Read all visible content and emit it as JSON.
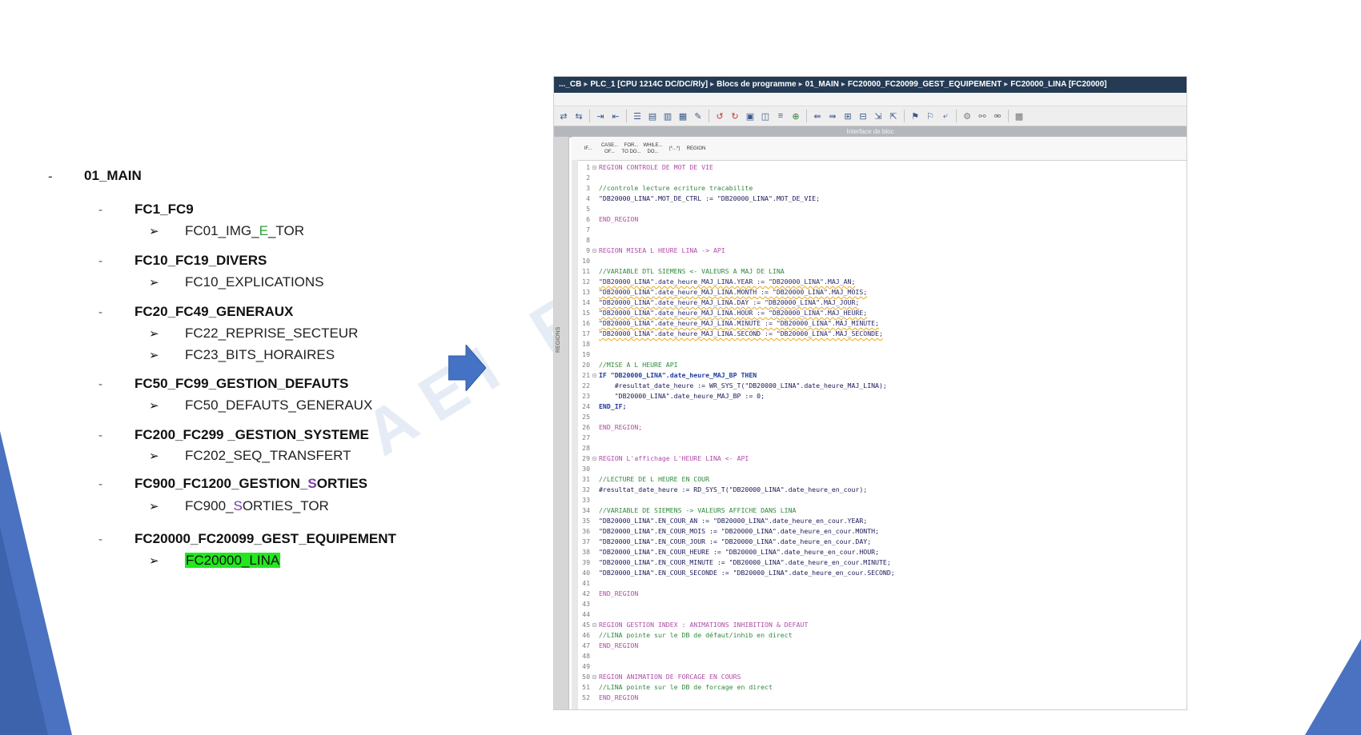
{
  "outline": {
    "root": {
      "dash": "-",
      "label": "01_MAIN"
    },
    "sections": [
      {
        "dash": "-",
        "label": "FC1_FC9",
        "items": [
          {
            "arrow": "➢",
            "parts": [
              {
                "text": "FC01_IMG_"
              },
              {
                "text": "E",
                "style": "green"
              },
              {
                "text": "_TOR"
              }
            ]
          }
        ]
      },
      {
        "dash": "-",
        "label": "FC10_FC19_DIVERS",
        "items": [
          {
            "arrow": "➢",
            "parts": [
              {
                "text": "FC10_EXPLICATIONS"
              }
            ]
          }
        ]
      },
      {
        "dash": "-",
        "label": "FC20_FC49_GENERAUX",
        "items": [
          {
            "arrow": "➢",
            "parts": [
              {
                "text": "FC22_REPRISE_SECTEUR"
              }
            ]
          },
          {
            "arrow": "➢",
            "parts": [
              {
                "text": "FC23_BITS_HORAIRES"
              }
            ]
          }
        ]
      },
      {
        "dash": "-",
        "label": "FC50_FC99_GESTION_DEFAUTS",
        "items": [
          {
            "arrow": "➢",
            "parts": [
              {
                "text": "FC50_DEFAUTS_GENERAUX"
              }
            ]
          }
        ]
      },
      {
        "dash": "-",
        "label": "FC200_FC299 _GESTION_SYSTEME",
        "items": [
          {
            "arrow": "➢",
            "parts": [
              {
                "text": "FC202_SEQ_TRANSFERT"
              }
            ]
          }
        ]
      },
      {
        "dash": "-",
        "label_parts": [
          {
            "text": "FC900_FC1200_GESTION_"
          },
          {
            "text": "S",
            "style": "purple"
          },
          {
            "text": "ORTIES"
          }
        ],
        "items": [
          {
            "arrow": "➢",
            "parts": [
              {
                "text": "FC900_"
              },
              {
                "text": "S",
                "style": "purple"
              },
              {
                "text": "ORTIES_TOR"
              }
            ]
          }
        ]
      },
      {
        "dash": "-",
        "label": "FC20000_FC20099_GEST_EQUIPEMENT",
        "items": [
          {
            "arrow": "➢",
            "parts": [
              {
                "text": "FC20000_LINA",
                "style": "highlight"
              }
            ]
          }
        ]
      }
    ]
  },
  "watermark": "AEI FO",
  "editor": {
    "breadcrumb": [
      "..._CB",
      "PLC_1 [CPU 1214C DC/DC/Rly]",
      "Blocs de programme",
      "01_MAIN",
      "FC20000_FC20099_GEST_EQUIPEMENT",
      "FC20000_LINA [FC20000]"
    ],
    "breadcrumb_separator": "▸",
    "interface_label": "Interface de bloc",
    "side_label": "REGIONS",
    "snippets": [
      "IF...",
      "CASE... OF...",
      "FOR... TO DO...",
      "WHILE... DO...",
      "(*...*)",
      "REGION"
    ],
    "code_lines": [
      {
        "n": "1",
        "fold": "⊟",
        "text": "REGION CONTROLE DE MOT DE VIE",
        "type": "region"
      },
      {
        "n": "2",
        "fold": "",
        "text": "",
        "type": "plain"
      },
      {
        "n": "3",
        "fold": "",
        "text": "//controle lecture ecriture tracabilite",
        "type": "comment"
      },
      {
        "n": "4",
        "fold": "",
        "text": "\"DB20000_LINA\".MOT_DE_CTRL := \"DB20000_LINA\".MOT_DE_VIE;",
        "type": "plain"
      },
      {
        "n": "5",
        "fold": "",
        "text": "",
        "type": "plain"
      },
      {
        "n": "6",
        "fold": "",
        "text": "END_REGION",
        "type": "region"
      },
      {
        "n": "7",
        "fold": "",
        "text": "",
        "type": "plain"
      },
      {
        "n": "8",
        "fold": "",
        "text": "",
        "type": "plain"
      },
      {
        "n": "9",
        "fold": "⊟",
        "text": "REGION MISEA L HEURE LINA -> API",
        "type": "region"
      },
      {
        "n": "10",
        "fold": "",
        "text": "",
        "type": "plain"
      },
      {
        "n": "11",
        "fold": "",
        "text": "//VARIABLE DTL SIEMENS <- VALEURS A MAJ DE LINA",
        "type": "comment"
      },
      {
        "n": "12",
        "fold": "",
        "text": "\"DB20000_LINA\".date_heure_MAJ_LINA.YEAR := \"DB20000_LINA\".MAJ_AN;",
        "type": "warn"
      },
      {
        "n": "13",
        "fold": "",
        "text": "\"DB20000_LINA\".date_heure_MAJ_LINA.MONTH := \"DB20000_LINA\".MAJ_MOIS;",
        "type": "warn"
      },
      {
        "n": "14",
        "fold": "",
        "text": "\"DB20000_LINA\".date_heure_MAJ_LINA.DAY := \"DB20000_LINA\".MAJ_JOUR;",
        "type": "warn"
      },
      {
        "n": "15",
        "fold": "",
        "text": "\"DB20000_LINA\".date_heure_MAJ_LINA.HOUR := \"DB20000_LINA\".MAJ_HEURE;",
        "type": "warn"
      },
      {
        "n": "16",
        "fold": "",
        "text": "\"DB20000_LINA\".date_heure_MAJ_LINA.MINUTE := \"DB20000_LINA\".MAJ_MINUTE;",
        "type": "warn"
      },
      {
        "n": "17",
        "fold": "",
        "text": "\"DB20000_LINA\".date_heure_MAJ_LINA.SECOND := \"DB20000_LINA\".MAJ_SECONDE;",
        "type": "warn"
      },
      {
        "n": "18",
        "fold": "",
        "text": "",
        "type": "plain"
      },
      {
        "n": "19",
        "fold": "",
        "text": "",
        "type": "plain"
      },
      {
        "n": "20",
        "fold": "",
        "text": "//MISE A L HEURE API",
        "type": "comment"
      },
      {
        "n": "21",
        "fold": "⊟",
        "text": "IF \"DB20000_LINA\".date_heure_MAJ_BP THEN",
        "type": "kw"
      },
      {
        "n": "22",
        "fold": "",
        "text": "    #resultat_date_heure := WR_SYS_T(\"DB20000_LINA\".date_heure_MAJ_LINA);",
        "type": "plain"
      },
      {
        "n": "23",
        "fold": "",
        "text": "    \"DB20000_LINA\".date_heure_MAJ_BP := 0;",
        "type": "plain"
      },
      {
        "n": "24",
        "fold": "",
        "text": "END_IF;",
        "type": "kw"
      },
      {
        "n": "25",
        "fold": "",
        "text": "",
        "type": "plain"
      },
      {
        "n": "26",
        "fold": "",
        "text": "END_REGION;",
        "type": "region"
      },
      {
        "n": "27",
        "fold": "",
        "text": "",
        "type": "plain"
      },
      {
        "n": "28",
        "fold": "",
        "text": "",
        "type": "plain"
      },
      {
        "n": "29",
        "fold": "⊟",
        "text": "REGION L'affichage L'HEURE LINA <- API",
        "type": "region"
      },
      {
        "n": "30",
        "fold": "",
        "text": "",
        "type": "plain"
      },
      {
        "n": "31",
        "fold": "",
        "text": "//LECTURE DE L HEURE EN COUR",
        "type": "comment"
      },
      {
        "n": "32",
        "fold": "",
        "text": "#resultat_date_heure := RD_SYS_T(\"DB20000_LINA\".date_heure_en_cour);",
        "type": "plain"
      },
      {
        "n": "33",
        "fold": "",
        "text": "",
        "type": "plain"
      },
      {
        "n": "34",
        "fold": "",
        "text": "//VARIABLE DE SIEMENS -> VALEURS AFFICHE DANS LINA",
        "type": "comment"
      },
      {
        "n": "35",
        "fold": "",
        "text": "\"DB20000_LINA\".EN_COUR_AN := \"DB20000_LINA\".date_heure_en_cour.YEAR;",
        "type": "plain"
      },
      {
        "n": "36",
        "fold": "",
        "text": "\"DB20000_LINA\".EN_COUR_MOIS := \"DB20000_LINA\".date_heure_en_cour.MONTH;",
        "type": "plain"
      },
      {
        "n": "37",
        "fold": "",
        "text": "\"DB20000_LINA\".EN_COUR_JOUR := \"DB20000_LINA\".date_heure_en_cour.DAY;",
        "type": "plain"
      },
      {
        "n": "38",
        "fold": "",
        "text": "\"DB20000_LINA\".EN_COUR_HEURE := \"DB20000_LINA\".date_heure_en_cour.HOUR;",
        "type": "plain"
      },
      {
        "n": "39",
        "fold": "",
        "text": "\"DB20000_LINA\".EN_COUR_MINUTE := \"DB20000_LINA\".date_heure_en_cour.MINUTE;",
        "type": "plain"
      },
      {
        "n": "40",
        "fold": "",
        "text": "\"DB20000_LINA\".EN_COUR_SECONDE := \"DB20000_LINA\".date_heure_en_cour.SECOND;",
        "type": "plain"
      },
      {
        "n": "41",
        "fold": "",
        "text": "",
        "type": "plain"
      },
      {
        "n": "42",
        "fold": "",
        "text": "END_REGION",
        "type": "region"
      },
      {
        "n": "43",
        "fold": "",
        "text": "",
        "type": "plain"
      },
      {
        "n": "44",
        "fold": "",
        "text": "",
        "type": "plain"
      },
      {
        "n": "45",
        "fold": "⊟",
        "text": "REGION GESTION INDEX : ANIMATIONS INHIBITION & DEFAUT",
        "type": "region"
      },
      {
        "n": "46",
        "fold": "",
        "text": "//LINA pointe sur le DB de défaut/inhib en direct",
        "type": "comment"
      },
      {
        "n": "47",
        "fold": "",
        "text": "END_REGION",
        "type": "region"
      },
      {
        "n": "48",
        "fold": "",
        "text": "",
        "type": "plain"
      },
      {
        "n": "49",
        "fold": "",
        "text": "",
        "type": "plain"
      },
      {
        "n": "50",
        "fold": "⊟",
        "text": "REGION ANIMATION DE FORCAGE EN COURS",
        "type": "region"
      },
      {
        "n": "51",
        "fold": "",
        "text": "//LINA pointe sur le DB de forcage en direct",
        "type": "comment"
      },
      {
        "n": "52",
        "fold": "",
        "text": "END_REGION",
        "type": "region"
      }
    ]
  },
  "colors": {
    "accent_blue": "#4472c4",
    "breadcrumb_bg": "#243b53",
    "highlight_green": "#22e81e"
  }
}
